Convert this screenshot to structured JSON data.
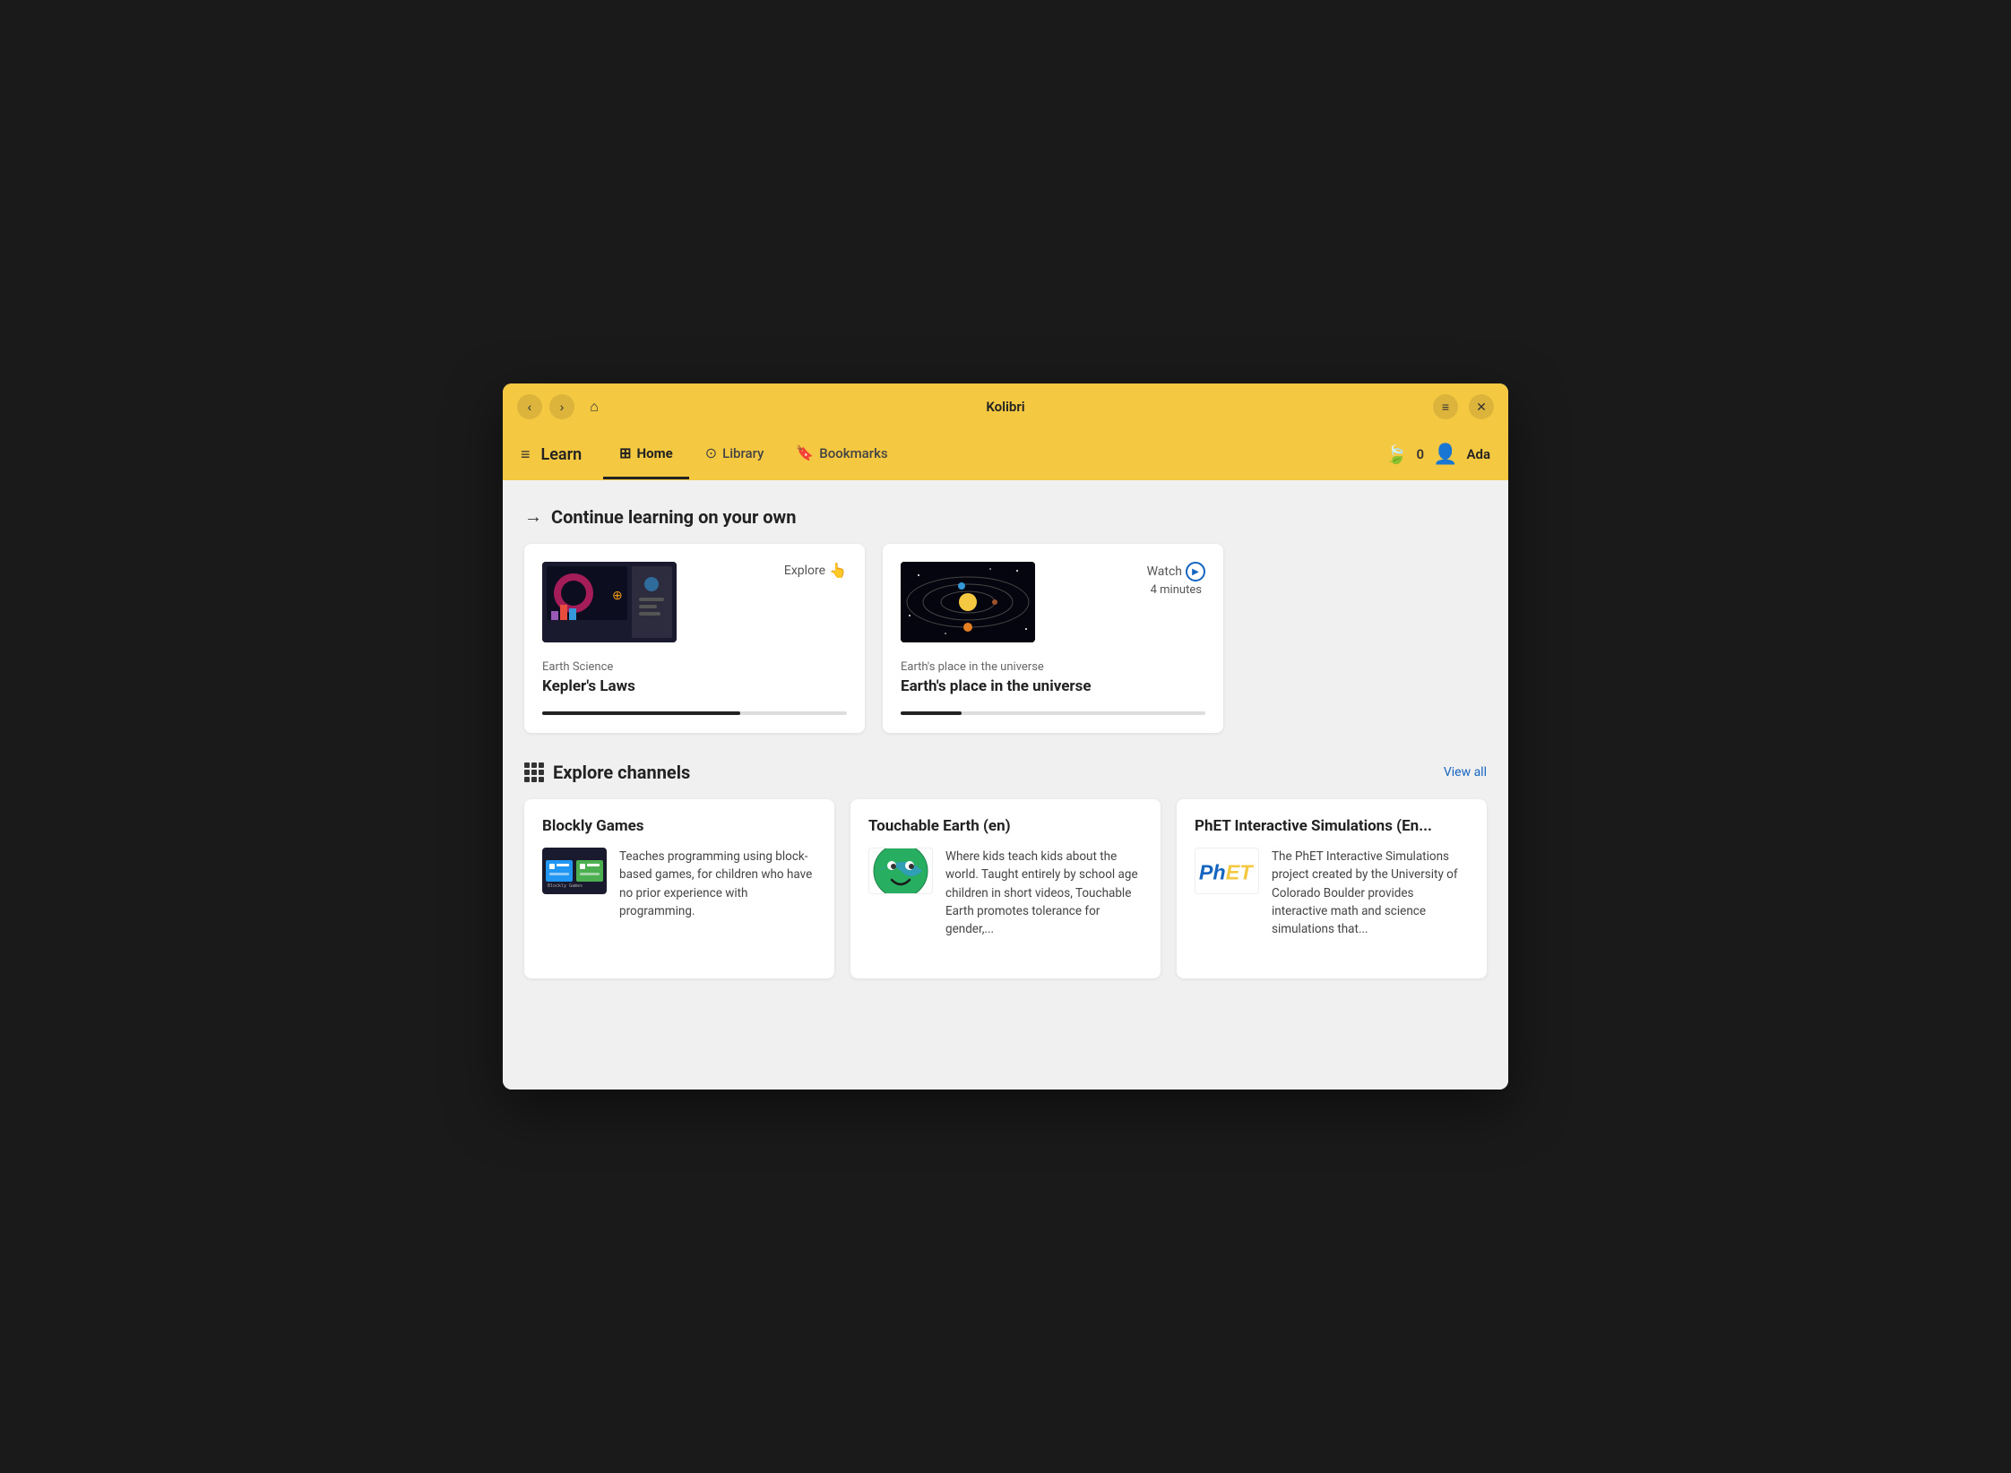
{
  "window": {
    "title": "Kolibri"
  },
  "titlebar": {
    "back_label": "‹",
    "forward_label": "›",
    "home_label": "⌂",
    "menu_label": "≡",
    "close_label": "✕"
  },
  "navbar": {
    "hamburger_label": "≡",
    "learn_label": "Learn",
    "tabs": [
      {
        "id": "home",
        "icon": "⊞",
        "label": "Home",
        "active": true
      },
      {
        "id": "library",
        "icon": "⊙",
        "label": "Library",
        "active": false
      },
      {
        "id": "bookmarks",
        "icon": "🔖",
        "label": "Bookmarks",
        "active": false
      }
    ],
    "points_icon": "🍃",
    "points_count": "0",
    "username": "Ada"
  },
  "sections": {
    "continue_learning": {
      "title": "Continue learning on your own",
      "cards": [
        {
          "id": "kepler",
          "action_label": "Explore",
          "action_icon": "👆",
          "category": "Earth Science",
          "title": "Kepler's Laws",
          "progress": 65
        },
        {
          "id": "earth_universe",
          "action_label": "Watch",
          "action_time": "4 minutes",
          "category": "Earth's place in the universe",
          "title": "Earth's place in the universe",
          "progress": 20
        }
      ]
    },
    "explore_channels": {
      "title": "Explore channels",
      "view_all_label": "View all",
      "channels": [
        {
          "id": "blockly",
          "title": "Blockly Games",
          "description": "Teaches programming using block-based games, for children who have no prior experience with programming.",
          "logo_type": "blockly"
        },
        {
          "id": "touchable",
          "title": "Touchable Earth (en)",
          "description": "Where kids teach kids about the world. Taught entirely by school age children in short videos, Touchable Earth promotes tolerance for gender,...",
          "logo_type": "touchable"
        },
        {
          "id": "phet",
          "title": "PhET Interactive Simulations (En...",
          "description": "The PhET Interactive Simulations project created by the University of Colorado Boulder provides interactive math and science simulations that...",
          "logo_type": "phet"
        }
      ]
    }
  }
}
